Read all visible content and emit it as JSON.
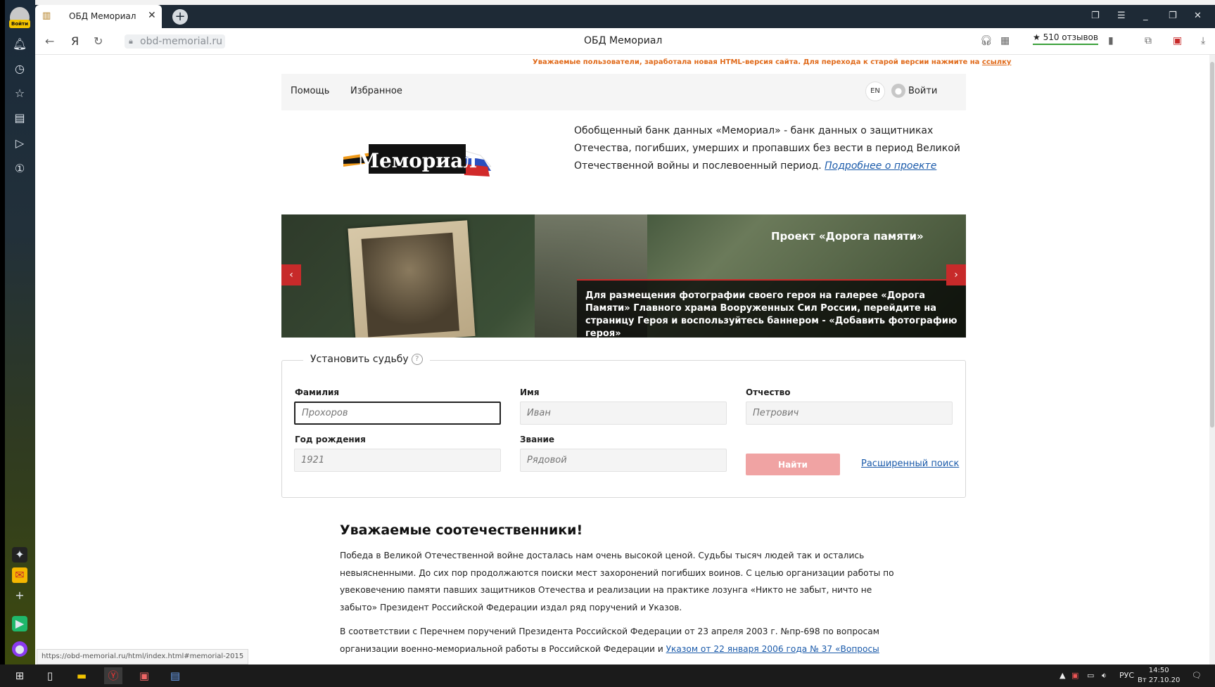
{
  "browser": {
    "login_badge": "Войти",
    "tab_title": "ОБД Мемориал",
    "tab_close": "✕",
    "new_tab": "+",
    "url": "obd-memorial.ru",
    "page_title": "ОБД Мемориал",
    "reviews": "★ 510 отзывов",
    "status_url": "https://obd-memorial.ru/html/index.html#memorial-2015"
  },
  "site": {
    "notice_text": "Уважаемые пользователи, заработала новая HTML-версия сайта. Для перехода к старой версии нажмите на ",
    "notice_link": "ссылку",
    "nav_help": "Помощь",
    "nav_favorites": "Избранное",
    "lang": "EN",
    "login": "Войти",
    "logo_text": "Мемориал",
    "intro_text": "Обобщенный банк данных «Мемориал» - банк данных о защитниках Отечества, погибших, умерших и пропавших без вести в период Великой Отечественной войны и послевоенный период. ",
    "intro_link": "Подробнее о проекте"
  },
  "banner": {
    "title": "Проект «Дорога памяти»",
    "caption": "Для размещения фотографии своего героя на галерее «Дорога Памяти» Главного храма Вооруженных Сил России, перейдите на страницу Героя и воспользуйтесь баннером - «Добавить фотографию героя»",
    "prev": "‹",
    "next": "›"
  },
  "search": {
    "legend": "Установить судьбу",
    "help": "?",
    "surname_label": "Фамилия",
    "surname_placeholder": "Прохоров",
    "name_label": "Имя",
    "name_placeholder": "Иван",
    "patronymic_label": "Отчество",
    "patronymic_placeholder": "Петрович",
    "birth_label": "Год рождения",
    "birth_placeholder": "1921",
    "rank_label": "Звание",
    "rank_placeholder": "Рядовой",
    "find_button": "Найти",
    "advanced_link": "Расширенный поиск"
  },
  "article": {
    "heading": "Уважаемые соотечественники!",
    "p1": "Победа в Великой Отечественной войне досталась нам очень высокой ценой. Судьбы тысяч людей так и остались невыясненными. До сих пор продолжаются поиски мест захоронений погибших воинов. С целью организации работы по увековечению памяти павших защитников Отечества и реализации на практике лозунга «Никто не забыт, ничто не забыто» Президент Российской Федерации издал ряд поручений и Указов.",
    "p2": "В соответствии с Перечнем поручений Президента Российской Федерации от 23 апреля 2003 г. №пр-698 по вопросам организации военно-мемориальной работы в Российской Федерации и ",
    "p2_link": "Указом от 22 января 2006 года № 37 «Вопросы"
  },
  "taskbar": {
    "lang": "РУС",
    "time": "14:50",
    "date": "Вт 27.10.20"
  }
}
